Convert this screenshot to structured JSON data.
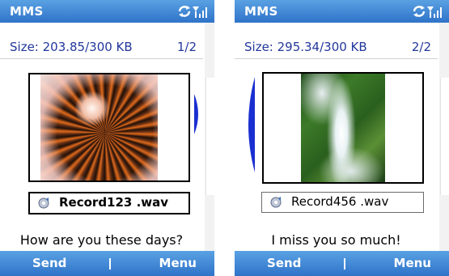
{
  "colors": {
    "title_bar": "#3b82d6",
    "size_text": "#23389b",
    "scroll_arrow": "#1a2fd1"
  },
  "screens": [
    {
      "title": "MMS",
      "size_label": "Size: 203.85/300 KB",
      "page_label": "1/2",
      "attachment": "Record123 .wav",
      "message": "How are you these days?",
      "left_softkey": "Send",
      "right_softkey": "Menu",
      "image": "flower-photo",
      "scroll_position": 0.5
    },
    {
      "title": "MMS",
      "size_label": "Size: 295.34/300 KB",
      "page_label": "2/2",
      "attachment": "Record456 .wav",
      "message": "I miss you so much!",
      "left_softkey": "Send",
      "right_softkey": "Menu",
      "image": "waterfall-photo",
      "scroll_position": 0.5
    }
  ]
}
